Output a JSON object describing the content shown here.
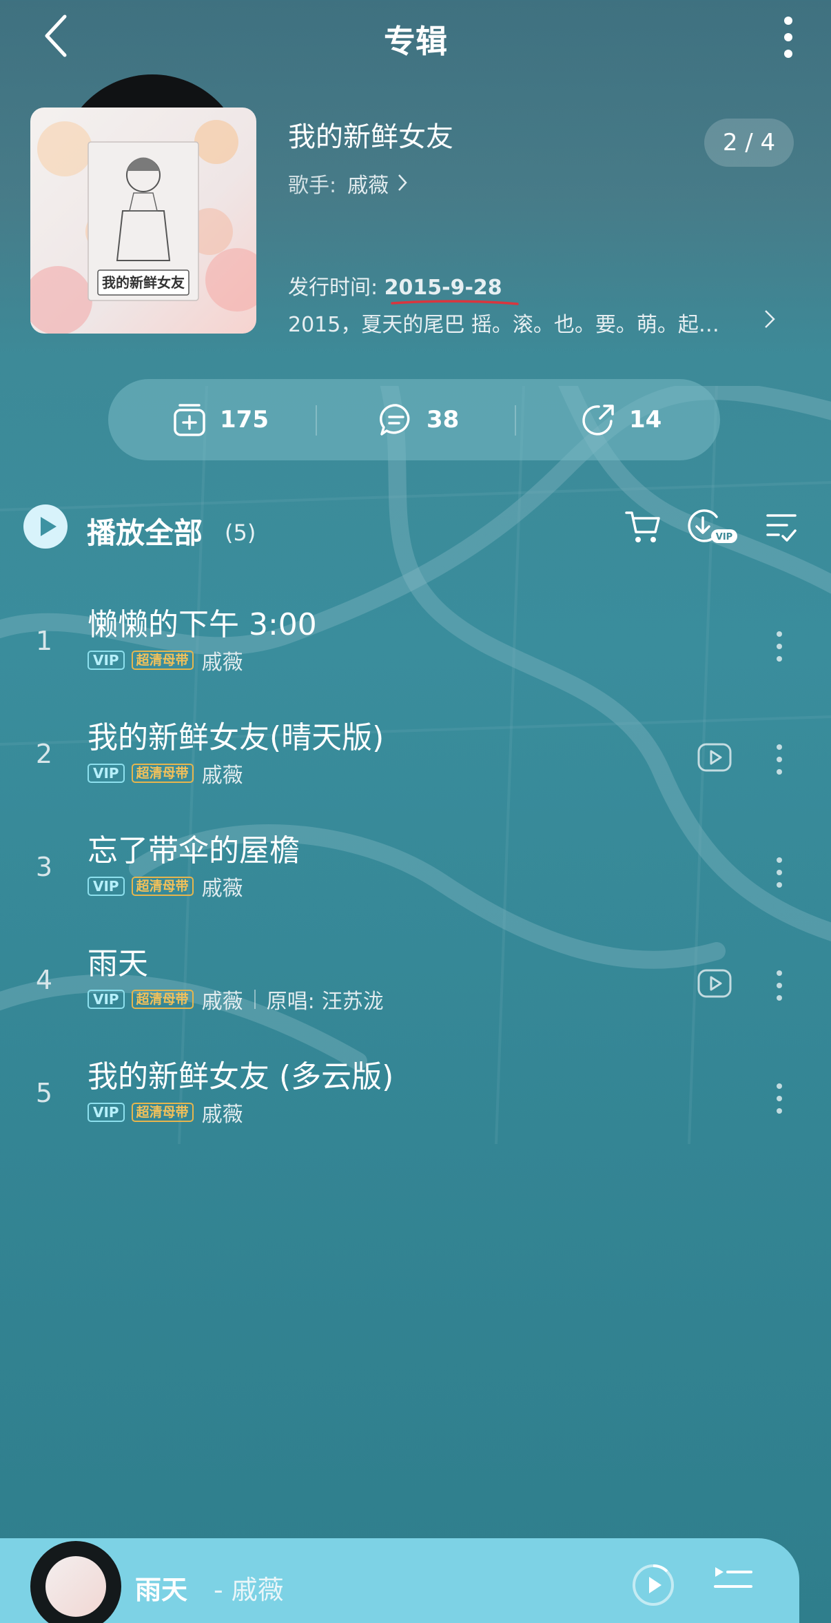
{
  "header": {
    "title": "专辑"
  },
  "album": {
    "name": "我的新鲜女友",
    "cover_text": "我的新鲜女友",
    "artist_label": "歌手:",
    "artist": "戚薇",
    "page_indicator": "2 / 4",
    "release_label": "发行时间:",
    "release_date": "2015-9-28",
    "description": "2015，夏天的尾巴 摇。滚。也。要。萌。起…"
  },
  "stats": {
    "favorites": "175",
    "comments": "38",
    "shares": "14"
  },
  "play_all": {
    "label": "播放全部",
    "count": "(5)"
  },
  "songs": [
    {
      "num": "1",
      "title": "懒懒的下午 3:00",
      "vip": "VIP",
      "quality": "超清母带",
      "artist": "戚薇",
      "has_mv": false,
      "original_label": "",
      "original": ""
    },
    {
      "num": "2",
      "title": "我的新鲜女友(晴天版)",
      "vip": "VIP",
      "quality": "超清母带",
      "artist": "戚薇",
      "has_mv": true,
      "original_label": "",
      "original": ""
    },
    {
      "num": "3",
      "title": "忘了带伞的屋檐",
      "vip": "VIP",
      "quality": "超清母带",
      "artist": "戚薇",
      "has_mv": false,
      "original_label": "",
      "original": ""
    },
    {
      "num": "4",
      "title": "雨天",
      "vip": "VIP",
      "quality": "超清母带",
      "artist": "戚薇",
      "has_mv": true,
      "original_label": "原唱:",
      "original": "汪苏泷"
    },
    {
      "num": "5",
      "title": "我的新鲜女友 (多云版)",
      "vip": "VIP",
      "quality": "超清母带",
      "artist": "戚薇",
      "has_mv": false,
      "original_label": "",
      "original": ""
    }
  ],
  "player": {
    "title": "雨天",
    "artist": "- 戚薇"
  },
  "colors": {
    "accent_red": "#d9363e",
    "vip_cyan": "#8de0ee",
    "quality_gold": "#e7b64d",
    "player_bar": "#7dd2e5"
  }
}
